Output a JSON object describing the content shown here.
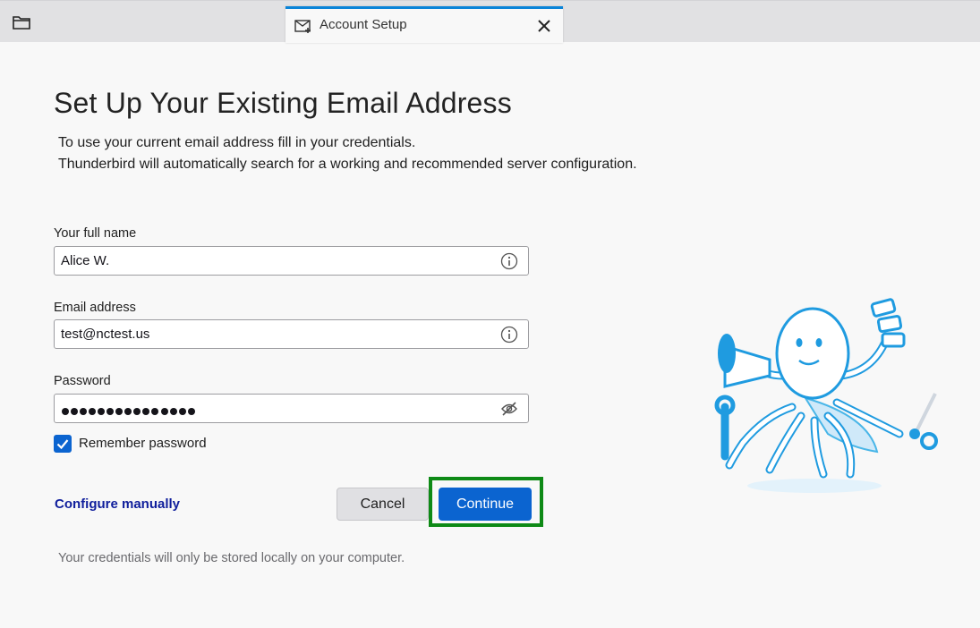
{
  "tab": {
    "title": "Account Setup"
  },
  "page": {
    "heading": "Set Up Your Existing Email Address",
    "description_line1": "To use your current email address fill in your credentials.",
    "description_line2": "Thunderbird will automatically search for a working and recommended server configuration."
  },
  "form": {
    "full_name_label": "Your full name",
    "full_name_value": "Alice W.",
    "email_label": "Email address",
    "email_value": "test@nctest.us",
    "password_label": "Password",
    "password_length": 15,
    "remember_label": "Remember password",
    "remember_checked": true
  },
  "actions": {
    "configure_manually": "Configure manually",
    "cancel": "Cancel",
    "continue": "Continue"
  },
  "footer": {
    "note": "Your credentials will only be stored locally on your computer."
  },
  "icons": {
    "folder": "folder-icon",
    "tab": "mail-setup-icon",
    "close": "close-icon",
    "info": "info-icon",
    "password_toggle": "eye-slash-icon",
    "check": "check-icon"
  },
  "colors": {
    "accent": "#0b64d0",
    "tab_indicator": "#0a84d8",
    "highlight": "#0e8a16",
    "link": "#0f1e9c"
  }
}
